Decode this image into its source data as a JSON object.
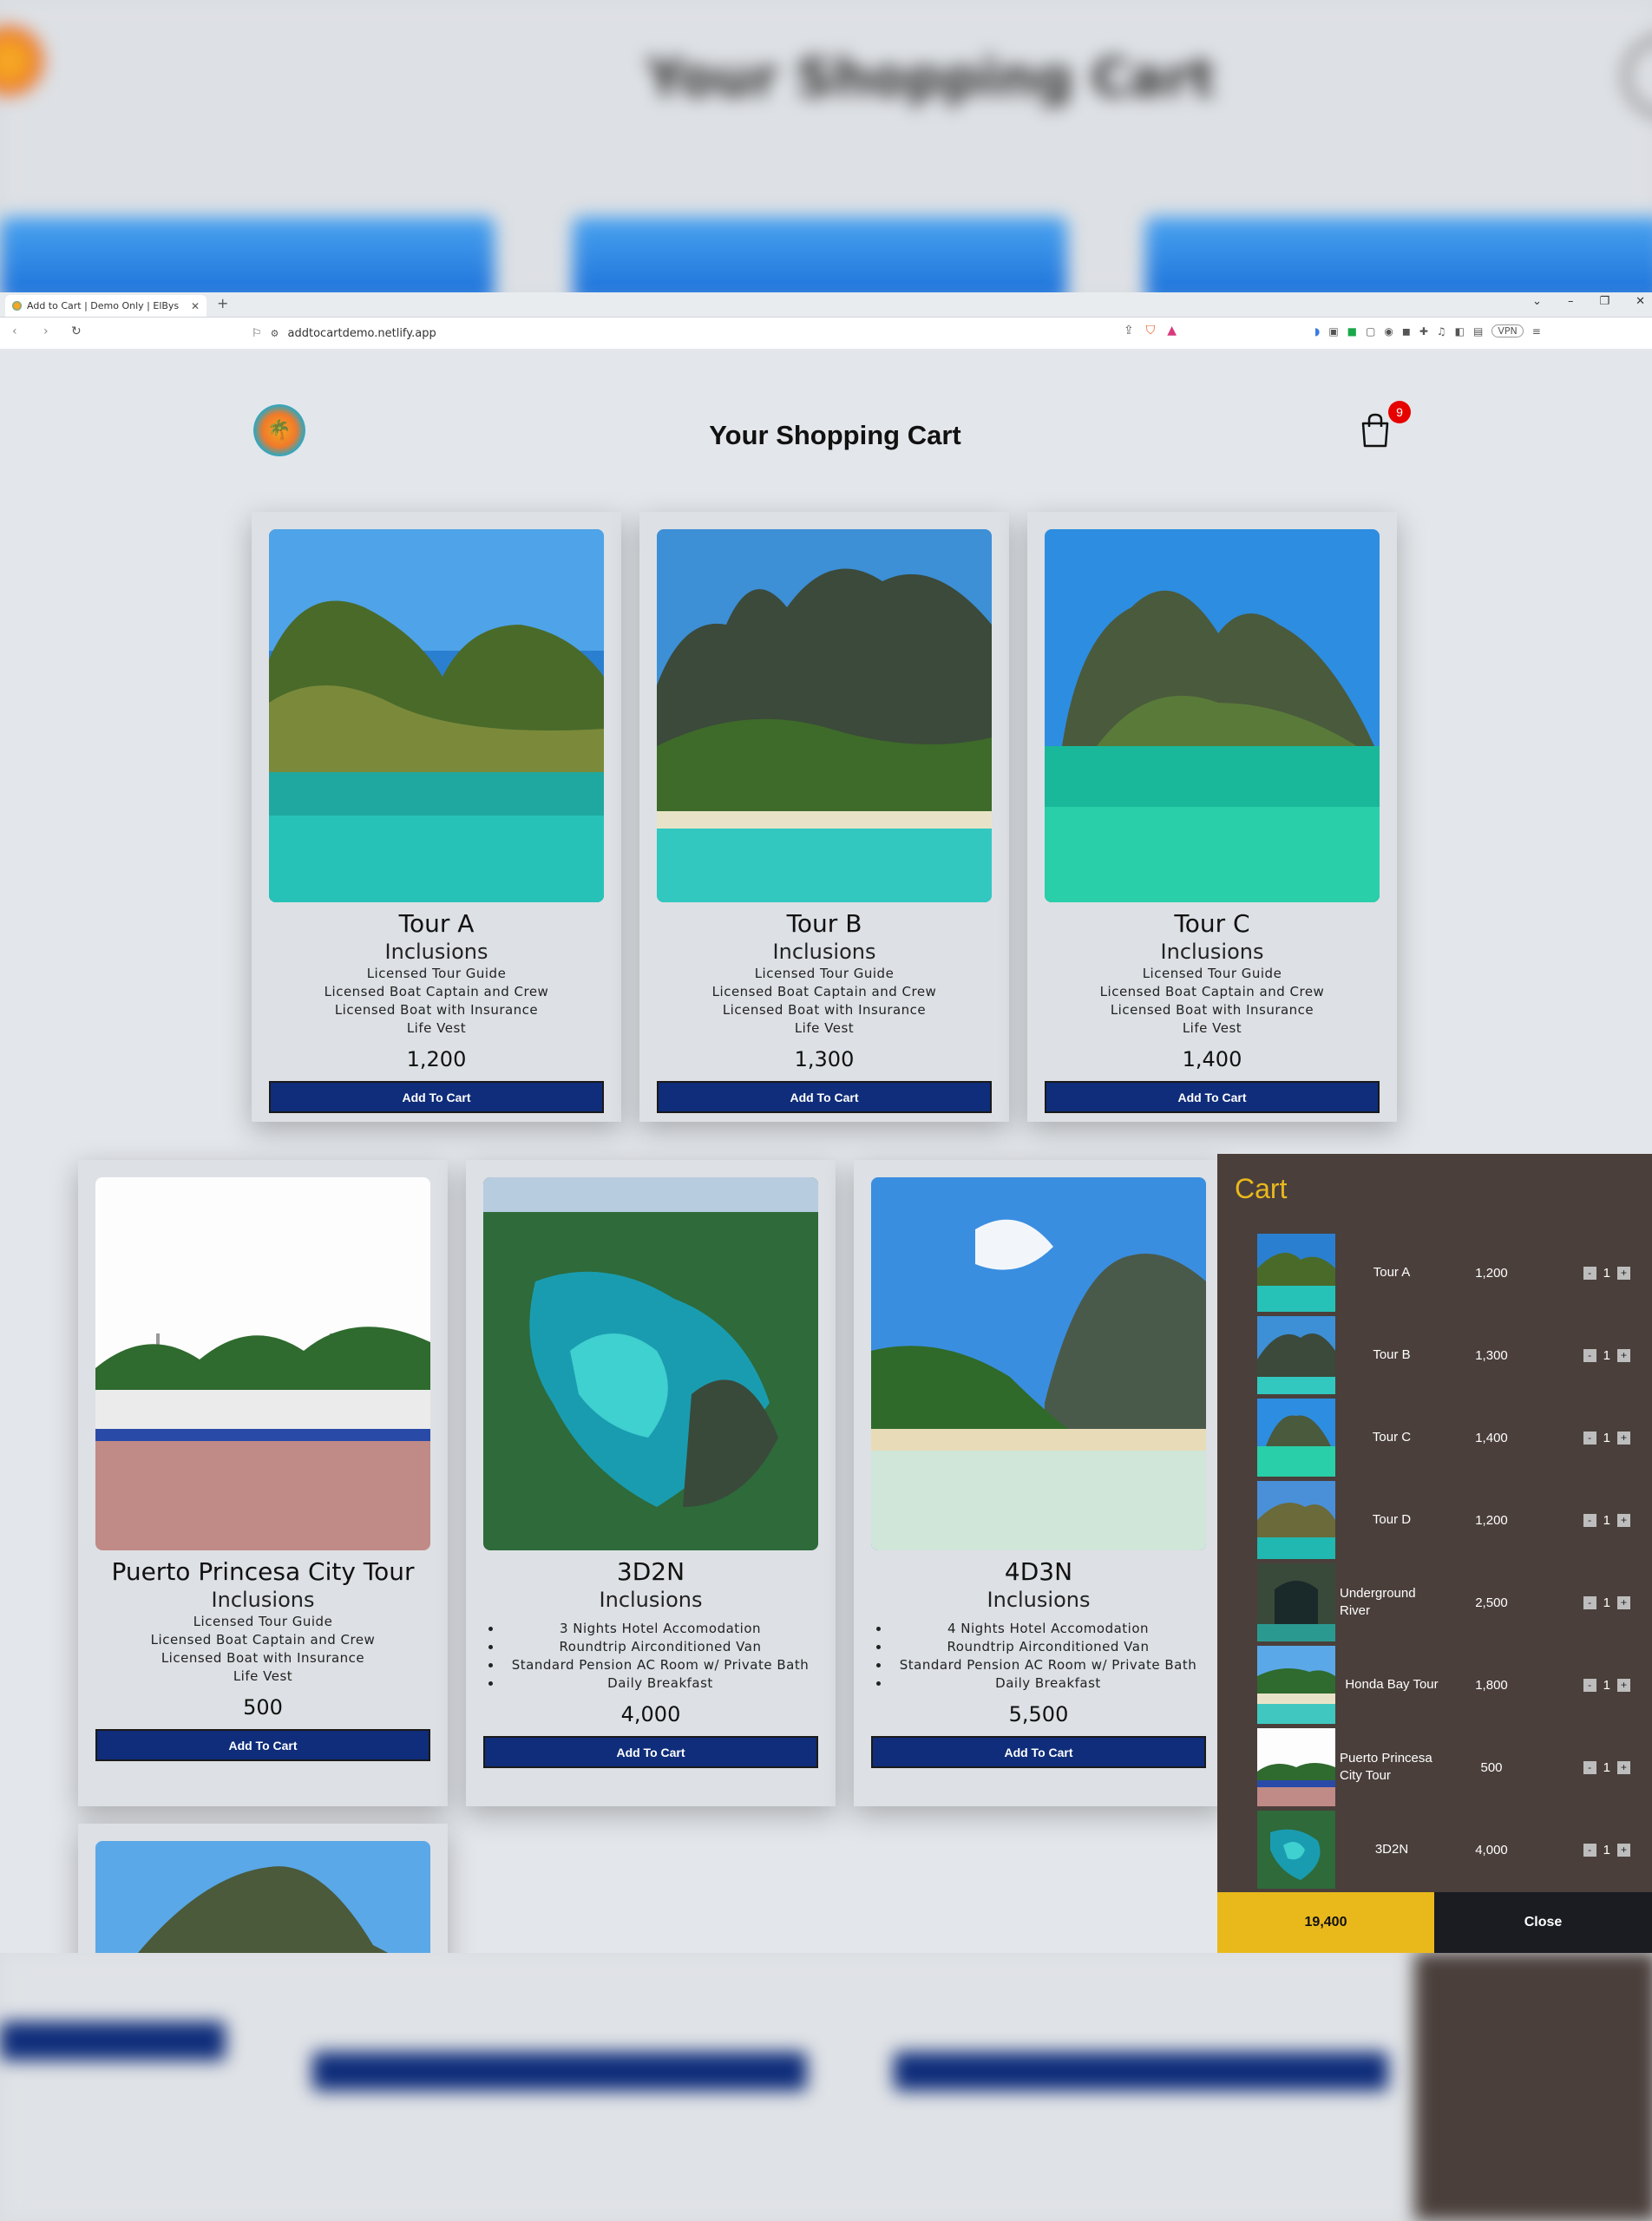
{
  "browser": {
    "tab_title": "Add to Cart | Demo Only | ElBys",
    "url": "addtocartdemo.netlify.app",
    "vpn": "VPN"
  },
  "header": {
    "title": "Your Shopping Cart",
    "cart_count": "9"
  },
  "backdrop": {
    "title": "Your Shopping Cart"
  },
  "products": [
    {
      "title": "Tour A",
      "subtitle": "Inclusions",
      "inclusions": [
        "Licensed Tour Guide",
        "Licensed Boat Captain and Crew",
        "Licensed Boat with Insurance",
        "Life Vest"
      ],
      "price": "1,200",
      "button": "Add To Cart"
    },
    {
      "title": "Tour B",
      "subtitle": "Inclusions",
      "inclusions": [
        "Licensed Tour Guide",
        "Licensed Boat Captain and Crew",
        "Licensed Boat with Insurance",
        "Life Vest"
      ],
      "price": "1,300",
      "button": "Add To Cart"
    },
    {
      "title": "Tour C",
      "subtitle": "Inclusions",
      "inclusions": [
        "Licensed Tour Guide",
        "Licensed Boat Captain and Crew",
        "Licensed Boat with Insurance",
        "Life Vest"
      ],
      "price": "1,400",
      "button": "Add To Cart"
    },
    {
      "title": "Puerto Princesa City Tour",
      "subtitle": "Inclusions",
      "inclusions": [
        "Licensed Tour Guide",
        "Licensed Boat Captain and Crew",
        "Licensed Boat with Insurance",
        "Life Vest"
      ],
      "price": "500",
      "button": "Add To Cart"
    },
    {
      "title": "3D2N",
      "subtitle": "Inclusions",
      "inclusions": [
        "3 Nights Hotel Accomodation",
        "Roundtrip Airconditioned Van",
        "Standard Pension AC Room w/ Private Bath",
        "Daily Breakfast"
      ],
      "price": "4,000",
      "button": "Add To Cart"
    },
    {
      "title": "4D3N",
      "subtitle": "Inclusions",
      "inclusions": [
        "4 Nights Hotel Accomodation",
        "Roundtrip Airconditioned Van",
        "Standard Pension AC Room w/ Private Bath",
        "Daily Breakfast"
      ],
      "price": "5,500",
      "button": "Add To Cart"
    }
  ],
  "cart": {
    "title": "Cart",
    "items": [
      {
        "name": "Tour A",
        "price": "1,200",
        "qty": "1"
      },
      {
        "name": "Tour B",
        "price": "1,300",
        "qty": "1"
      },
      {
        "name": "Tour C",
        "price": "1,400",
        "qty": "1"
      },
      {
        "name": "Tour D",
        "price": "1,200",
        "qty": "1"
      },
      {
        "name": "Underground River",
        "price": "2,500",
        "qty": "1"
      },
      {
        "name": "Honda Bay Tour",
        "price": "1,800",
        "qty": "1"
      },
      {
        "name": "Puerto Princesa City Tour",
        "price": "500",
        "qty": "1"
      },
      {
        "name": "3D2N",
        "price": "4,000",
        "qty": "1"
      }
    ],
    "minus": "-",
    "plus": "+",
    "total": "19,400",
    "close": "Close"
  }
}
